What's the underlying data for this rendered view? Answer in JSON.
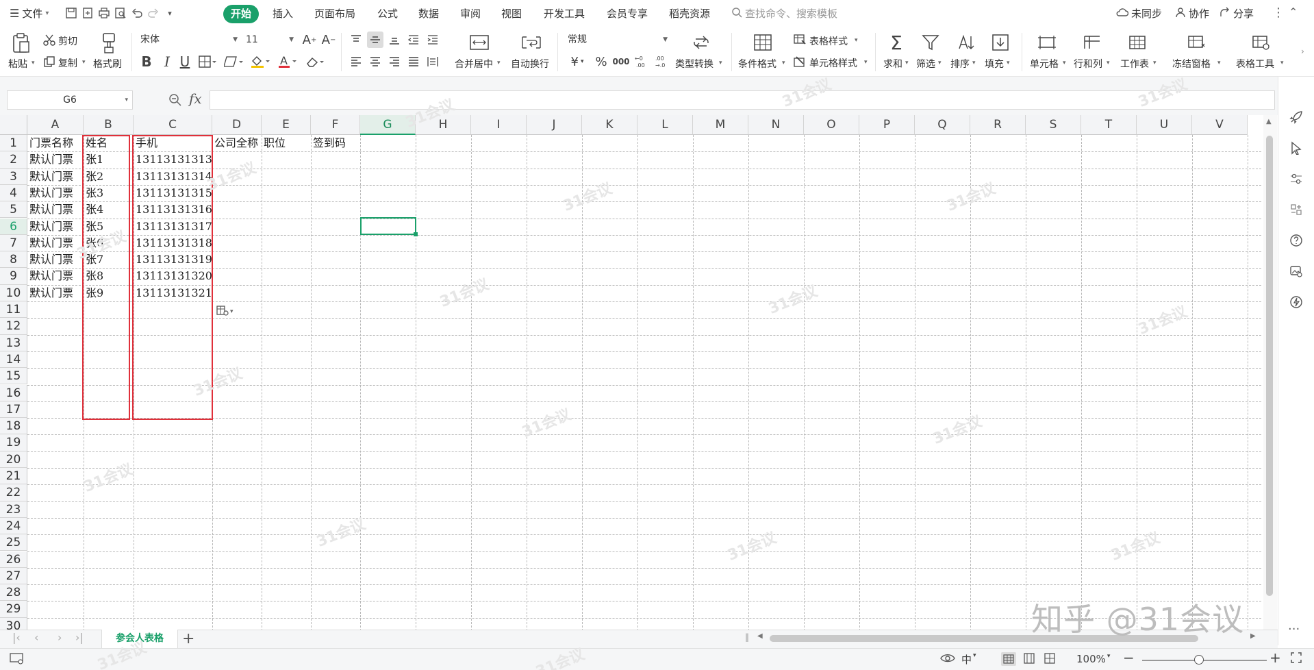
{
  "menubar": {
    "file_label": "文件",
    "tabs": [
      "开始",
      "插入",
      "页面布局",
      "公式",
      "数据",
      "审阅",
      "视图",
      "开发工具",
      "会员专享",
      "稻壳资源"
    ],
    "active_tab": "开始",
    "search_placeholder": "查找命令、搜索模板",
    "sync_label": "未同步",
    "collab_label": "协作",
    "share_label": "分享"
  },
  "ribbon": {
    "paste": "粘贴",
    "cut": "剪切",
    "copy": "复制",
    "format_painter": "格式刷",
    "font_name": "宋体",
    "font_size": "11",
    "merge_center": "合并居中",
    "wrap_text": "自动换行",
    "number_format": "常规",
    "type_convert": "类型转换",
    "conditional_format": "条件格式",
    "table_style": "表格样式",
    "cell_style": "单元格样式",
    "sum": "求和",
    "filter": "筛选",
    "sort": "排序",
    "fill": "填充",
    "cells": "单元格",
    "rows_cols": "行和列",
    "worksheet": "工作表",
    "freeze": "冻结窗格",
    "table_tools": "表格工具",
    "currency": "¥",
    "percent": "%",
    "thousands": "000"
  },
  "formula_bar": {
    "name_box": "G6",
    "fx": "fx",
    "content": ""
  },
  "sheet": {
    "columns": [
      "A",
      "B",
      "C",
      "D",
      "E",
      "F",
      "G",
      "H",
      "I",
      "J",
      "K",
      "L",
      "M",
      "N",
      "O",
      "P",
      "Q",
      "R",
      "S",
      "T",
      "U",
      "V"
    ],
    "rows": [
      "1",
      "2",
      "3",
      "4",
      "5",
      "6",
      "7",
      "8",
      "9",
      "10",
      "11",
      "12",
      "13",
      "14",
      "15",
      "16",
      "17",
      "18",
      "19",
      "20",
      "21",
      "22",
      "23",
      "24",
      "25",
      "26",
      "27",
      "28",
      "29",
      "30"
    ],
    "selected_cell": "G6",
    "header_row": [
      "门票名称",
      "姓名",
      "手机",
      "公司全称",
      "职位",
      "签到码"
    ],
    "data": [
      [
        "默认门票",
        "张1",
        "13113131313"
      ],
      [
        "默认门票",
        "张2",
        "13113131314"
      ],
      [
        "默认门票",
        "张3",
        "13113131315"
      ],
      [
        "默认门票",
        "张4",
        "13113131316"
      ],
      [
        "默认门票",
        "张5",
        "13113131317"
      ],
      [
        "默认门票",
        "张6",
        "13113131318"
      ],
      [
        "默认门票",
        "张7",
        "13113131319"
      ],
      [
        "默认门票",
        "张8",
        "13113131320"
      ],
      [
        "默认门票",
        "张9",
        "13113131321"
      ]
    ]
  },
  "sheet_tabs": [
    "参会人表格"
  ],
  "statusbar": {
    "zoom": "100%",
    "input_mode": "中"
  },
  "watermark": {
    "brand": "知乎 @31会议",
    "tile": "31会议"
  },
  "colors": {
    "accent": "#1aa06a",
    "highlight_border": "#e0303a"
  }
}
